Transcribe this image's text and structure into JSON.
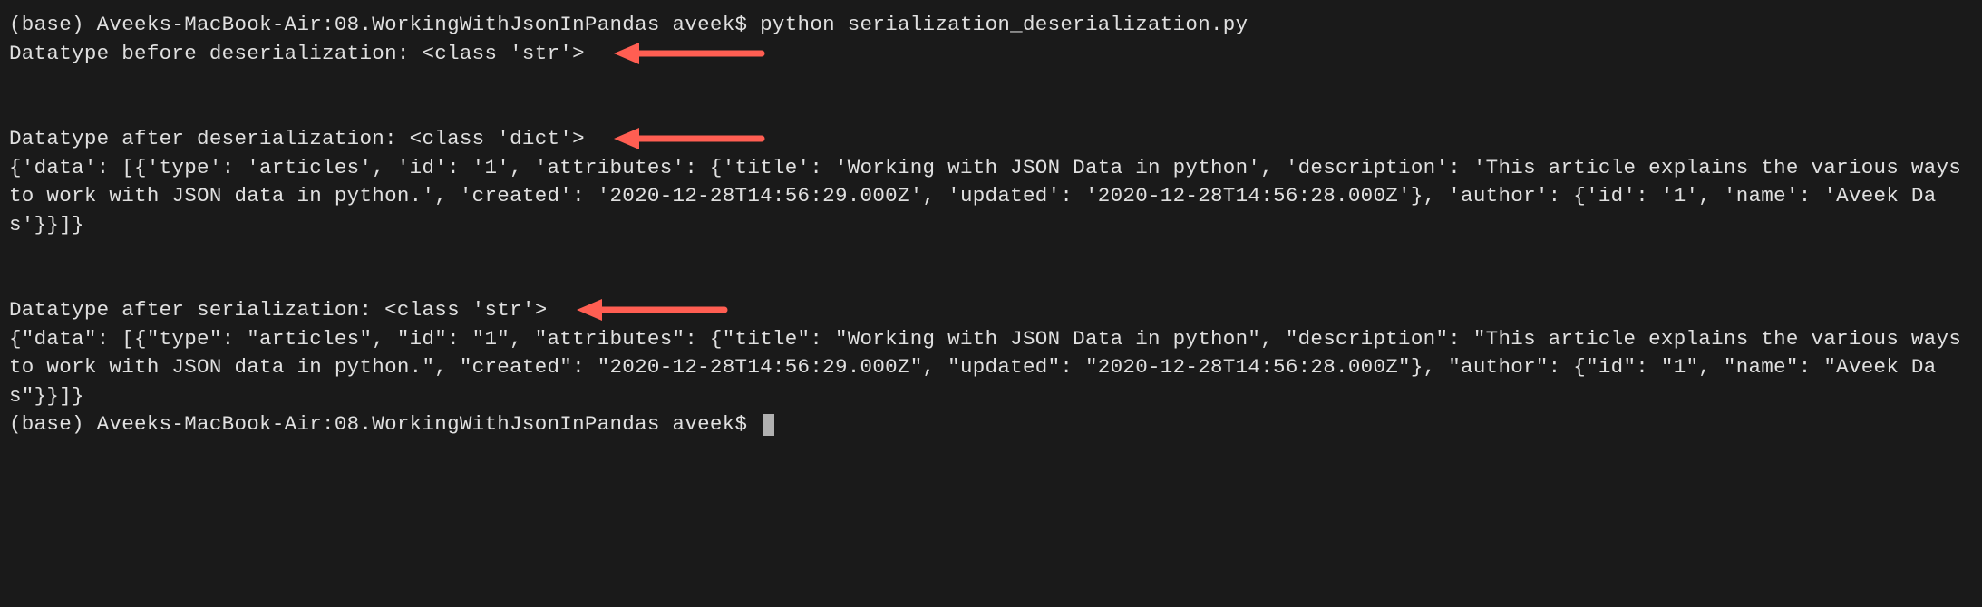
{
  "terminal": {
    "lines": [
      {
        "type": "text",
        "content": "(base) Aveeks-MacBook-Air:08.WorkingWithJsonInPandas aveek$ python serialization_deserialization.py"
      },
      {
        "type": "text-arrow",
        "content": "Datatype before deserialization: <class 'str'>"
      },
      {
        "type": "blank"
      },
      {
        "type": "blank"
      },
      {
        "type": "text-arrow",
        "content": "Datatype after deserialization: <class 'dict'>"
      },
      {
        "type": "text",
        "content": "{'data': [{'type': 'articles', 'id': '1', 'attributes': {'title': 'Working with JSON Data in python', 'description': 'This article explains the various ways to work with JSON data in python.', 'created': '2020-12-28T14:56:29.000Z', 'updated': '2020-12-28T14:56:28.000Z'}, 'author': {'id': '1', 'name': 'Aveek Das'}}]}"
      },
      {
        "type": "blank"
      },
      {
        "type": "blank"
      },
      {
        "type": "text-arrow",
        "content": "Datatype after serialization: <class 'str'>"
      },
      {
        "type": "text",
        "content": "{\"data\": [{\"type\": \"articles\", \"id\": \"1\", \"attributes\": {\"title\": \"Working with JSON Data in python\", \"description\": \"This article explains the various ways to work with JSON data in python.\", \"created\": \"2020-12-28T14:56:29.000Z\", \"updated\": \"2020-12-28T14:56:28.000Z\"}, \"author\": {\"id\": \"1\", \"name\": \"Aveek Das\"}}]}"
      },
      {
        "type": "prompt",
        "content": "(base) Aveeks-MacBook-Air:08.WorkingWithJsonInPandas aveek$ "
      }
    ]
  },
  "arrow_color": "#ff5e52"
}
